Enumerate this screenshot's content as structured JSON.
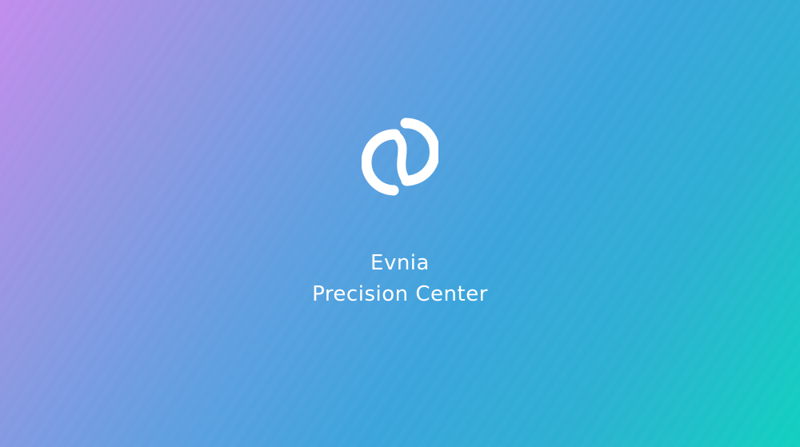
{
  "app": {
    "name_line1": "Evnia",
    "name_line2": "Precision Center",
    "logo_icon": "evnia-logo-icon"
  },
  "colors": {
    "gradient_start": "#c28ced",
    "gradient_mid": "#3ba4dc",
    "gradient_end": "#10d0bf",
    "text": "#ffffff"
  }
}
